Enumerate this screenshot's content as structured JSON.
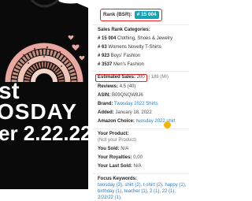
{
  "image": {
    "line1": "st",
    "line2": "OSDAY",
    "line3": "er 2.22.22"
  },
  "rank": {
    "label": "Rank (BSR):",
    "value": "# 15 004"
  },
  "categories": {
    "label": "Sales Rank Categories:",
    "items": [
      {
        "num": "# 15 004",
        "name": "Clothing, Shoes & Jewelry"
      },
      {
        "num": "# 63",
        "name": "Womens Novelty T-Shirts"
      },
      {
        "num": "# 923",
        "name": "Boys' Fashion"
      },
      {
        "num": "# 3537",
        "name": "Men's Fashion"
      }
    ]
  },
  "estimated_sales": {
    "label": "Estimated Sales:",
    "value": "200",
    "extra": "| 189 (MI)"
  },
  "reviews": {
    "label": "Reviews:",
    "value": "4.5 (40)"
  },
  "asin": {
    "label": "ASIN:",
    "value": "B09QNQW8J6"
  },
  "brand": {
    "label": "Brand:",
    "value": "Twosday 2022 Shirts"
  },
  "added": {
    "label": "Added:",
    "value": "January 18, 2022"
  },
  "amazon_choice": {
    "label": "Amazon Choice:",
    "value": "twosday 2022 shirt"
  },
  "your_product": {
    "label": "Your Product:",
    "value": "(Not your Product)"
  },
  "sold": {
    "label": "You Sold:",
    "value": "N/A"
  },
  "royalties": {
    "label": "Your Royalties:",
    "value": "0,00"
  },
  "last_sold": {
    "label": "Your Last Sold:",
    "value": "N/A"
  },
  "focus": {
    "label": "Focus Keywords:",
    "text": "twosday (3), shirt (2), t-shirt (2), happy (1), birthday (1), teacher (1), 2 (1), 22 (1), 2/22/22 (1),"
  },
  "colors": {
    "rank_badge": "#17a2b8",
    "highlight_border": "#e12727",
    "link": "#2a7fc1",
    "shirt": "#0a0a0a"
  }
}
